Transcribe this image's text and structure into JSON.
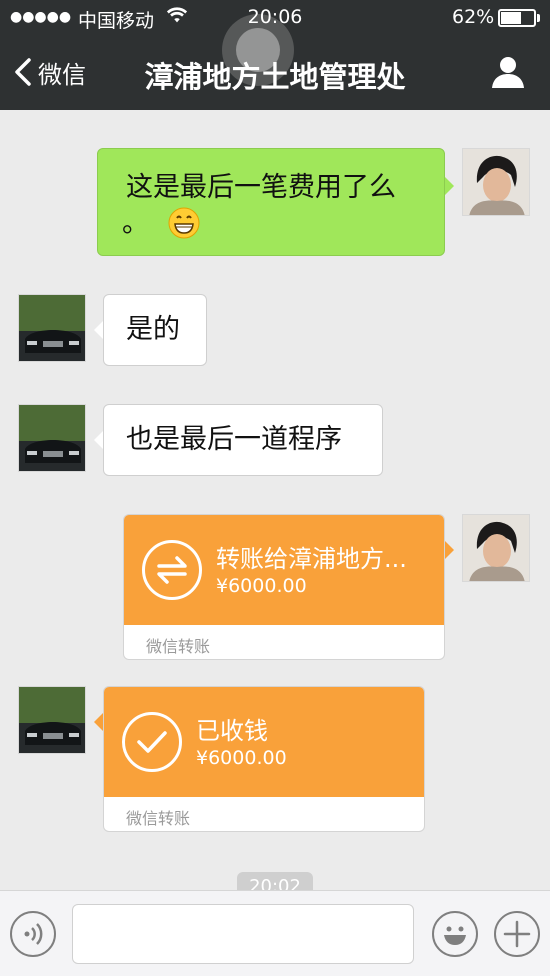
{
  "status_bar": {
    "signal": "●●●●●",
    "carrier": "中国移动",
    "time": "20:06",
    "battery_percent": "62%",
    "battery_level": 0.62
  },
  "nav": {
    "back_label": "微信",
    "title": "漳浦地方土地管理处"
  },
  "messages": [
    {
      "sender": "me",
      "type": "text",
      "text": "这是最后一笔费用了么",
      "text_line2": "。"
    },
    {
      "sender": "other",
      "type": "text",
      "text": "是的"
    },
    {
      "sender": "other",
      "type": "text",
      "text": "也是最后一道程序"
    },
    {
      "sender": "me",
      "type": "transfer",
      "title": "转账给漳浦地方...",
      "amount": "¥6000.00",
      "footer": "微信转账"
    },
    {
      "sender": "other",
      "type": "transfer",
      "title": "已收钱",
      "amount": "¥6000.00",
      "footer": "微信转账"
    }
  ],
  "timestamp": "20:02",
  "colors": {
    "nav_bg": "#2e3132",
    "chat_bg": "#ebebeb",
    "my_bubble": "#a0e75a",
    "transfer_orange": "#f9a13a"
  }
}
